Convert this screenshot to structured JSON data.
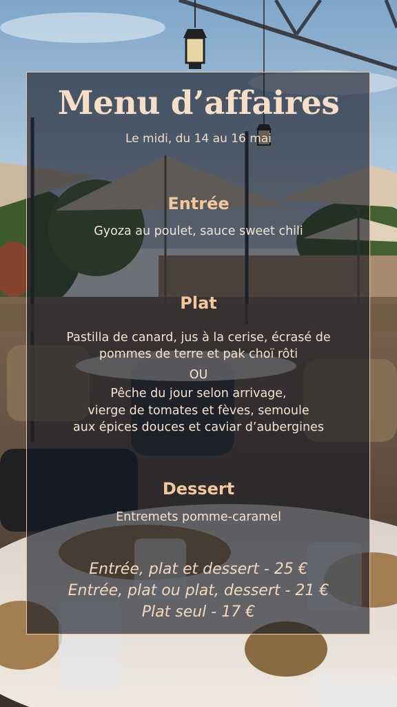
{
  "menu": {
    "title": "Menu d’affaires",
    "subtitle": "Le midi, du 14 au 16 mai",
    "sections": {
      "entree": {
        "heading": "Entrée",
        "dish": "Gyoza au poulet, sauce sweet chili"
      },
      "plat": {
        "heading": "Plat",
        "dish1_line1": "Pastilla de canard, jus à la cerise, écrasé de",
        "dish1_line2": "pommes de terre et pak choï rôti",
        "or": "OU",
        "dish2_line1": "Pêche du jour selon arrivage,",
        "dish2_line2": "vierge de tomates et fèves, semoule",
        "dish2_line3": "aux épices douces et caviar d’aubergines"
      },
      "dessert": {
        "heading": "Dessert",
        "dish": "Entremets pomme-caramel"
      }
    },
    "prices": [
      "Entrée, plat et dessert - 25 €",
      "Entrée, plat ou plat, dessert - 21 €",
      "Plat seul - 17 €"
    ]
  },
  "colors": {
    "accent": "#f2c89c",
    "text": "#f4e3d1",
    "border": "#e8c9a6",
    "overlay": "#121622"
  },
  "icons": {
    "lantern": "hanging-lantern-icon"
  }
}
